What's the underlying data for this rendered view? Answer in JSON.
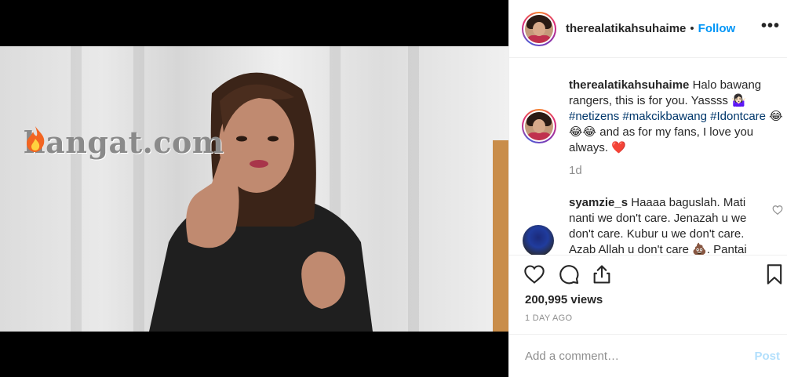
{
  "video": {
    "watermark": "hangat.com"
  },
  "header": {
    "username": "therealatikahsuhaime",
    "separator": "•",
    "follow_label": "Follow",
    "more_label": "•••"
  },
  "caption": {
    "username": "therealatikahsuhaime",
    "text_1": " Halo bawang rangers, this is for you. Yassss 🤷🏻‍♀️ ",
    "tag_1": "#netizens",
    "tag_2": "#makcikbawang",
    "tag_3": "#Idontcare",
    "text_2": " 😂😂😂 and as for my fans, I love you always. ❤️",
    "time": "1d"
  },
  "comment_2": {
    "username": "syamzie_s",
    "text": " Haaaa baguslah. Mati nanti we don't care. Jenazah u we don't care. Kubur u we don't care. Azab Allah u don't care 💩. Pantai"
  },
  "stats": {
    "views": "200,995 views",
    "posted_ago": "1 DAY AGO"
  },
  "add_comment": {
    "placeholder": "Add a comment…",
    "post_label": "Post"
  },
  "colors": {
    "accent": "#0095f6",
    "post_disabled": "#b2dffc",
    "muted": "#8e8e8e",
    "hashtag": "#00376b"
  },
  "icons": [
    "heart-icon",
    "comment-icon",
    "share-icon",
    "bookmark-icon",
    "more-icon",
    "fire-icon"
  ]
}
